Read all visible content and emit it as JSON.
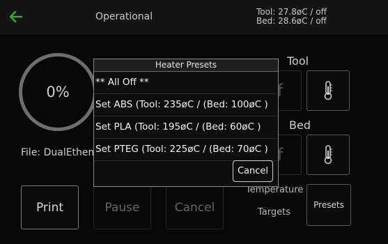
{
  "topbar": {
    "back_icon": "back-arrow-icon",
    "status": "Operational",
    "tool_temp": "Tool: 27.8øC / off",
    "bed_temp": "Bed: 28.6øC / off"
  },
  "job": {
    "progress_label": "0%",
    "file_label": "File: DualEthem"
  },
  "actions": {
    "print": "Print",
    "pause": "Pause",
    "cancel": "Cancel"
  },
  "heaters": {
    "tool_title": "Tool",
    "bed_title": "Bed",
    "temperature_label": "Temperature",
    "targets_label": "Targets",
    "presets_button": "Presets",
    "thermometer_icon": "thermometer-icon"
  },
  "dialog": {
    "title": "Heater Presets",
    "items": [
      "** All Off **",
      "Set ABS (Tool: 235øC  / (Bed: 100øC )",
      "Set PLA (Tool: 195øC  / (Bed: 60øC )",
      "Set PTEG (Tool: 225øC  / (Bed: 70øC )"
    ],
    "cancel_label": "Cancel"
  },
  "colors": {
    "accent_green": "#3aa63a",
    "background": "#080808",
    "dialog_border": "#8a8a8a"
  }
}
